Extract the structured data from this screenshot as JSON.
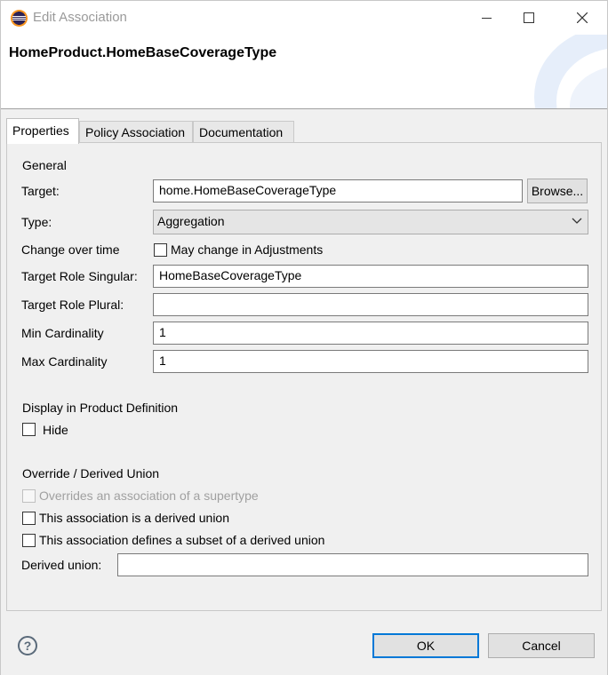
{
  "window": {
    "title": "Edit Association"
  },
  "banner": {
    "title": "HomeProduct.HomeBaseCoverageType"
  },
  "tabs": [
    "Properties",
    "Policy Association",
    "Documentation"
  ],
  "general": {
    "heading": "General",
    "target_label": "Target:",
    "target_value": "home.HomeBaseCoverageType",
    "browse_label": "Browse...",
    "type_label": "Type:",
    "type_value": "Aggregation",
    "change_label": "Change over time",
    "change_checkbox_label": "May change in Adjustments",
    "role_singular_label": "Target Role Singular:",
    "role_singular_value": "HomeBaseCoverageType",
    "role_plural_label": "Target Role Plural:",
    "role_plural_value": "",
    "min_label": "Min Cardinality",
    "min_value": "1",
    "max_label": "Max Cardinality",
    "max_value": "1"
  },
  "display": {
    "heading": "Display in Product Definition",
    "hide_label": "Hide"
  },
  "override": {
    "heading": "Override / Derived Union",
    "overrides_label": "Overrides an association of a supertype",
    "derived_union_label": "This association is a derived union",
    "subset_label": "This association defines a subset of a derived union",
    "derived_field_label": "Derived union:",
    "derived_field_value": ""
  },
  "footer": {
    "ok_label": "OK",
    "cancel_label": "Cancel"
  },
  "colors": {
    "accent": "#0078d7",
    "banner_deco": "#dbe6f5"
  }
}
